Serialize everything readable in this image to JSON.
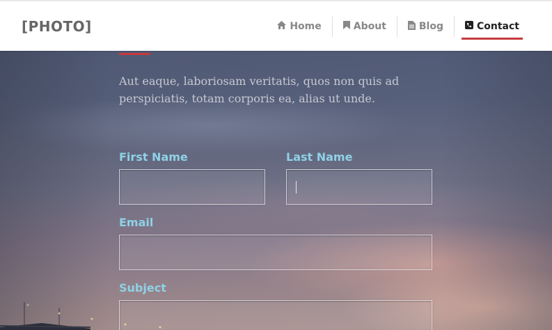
{
  "header": {
    "logo": "[PHOTO]",
    "nav": [
      {
        "label": "Home",
        "icon": "home-icon"
      },
      {
        "label": "About",
        "icon": "bookmark-icon"
      },
      {
        "label": "Blog",
        "icon": "document-icon"
      },
      {
        "label": "Contact",
        "icon": "phone-icon",
        "active": true
      }
    ],
    "accent_color": "#c7393b"
  },
  "intro": "Aut eaque, laboriosam veritatis, quos non quis ad perspiciatis, totam corporis ea, alias ut unde.",
  "form": {
    "first_name": {
      "label": "First Name",
      "value": ""
    },
    "last_name": {
      "label": "Last Name",
      "value": ""
    },
    "email": {
      "label": "Email",
      "value": ""
    },
    "subject": {
      "label": "Subject",
      "value": ""
    },
    "label_color": "#8fd1e6"
  }
}
